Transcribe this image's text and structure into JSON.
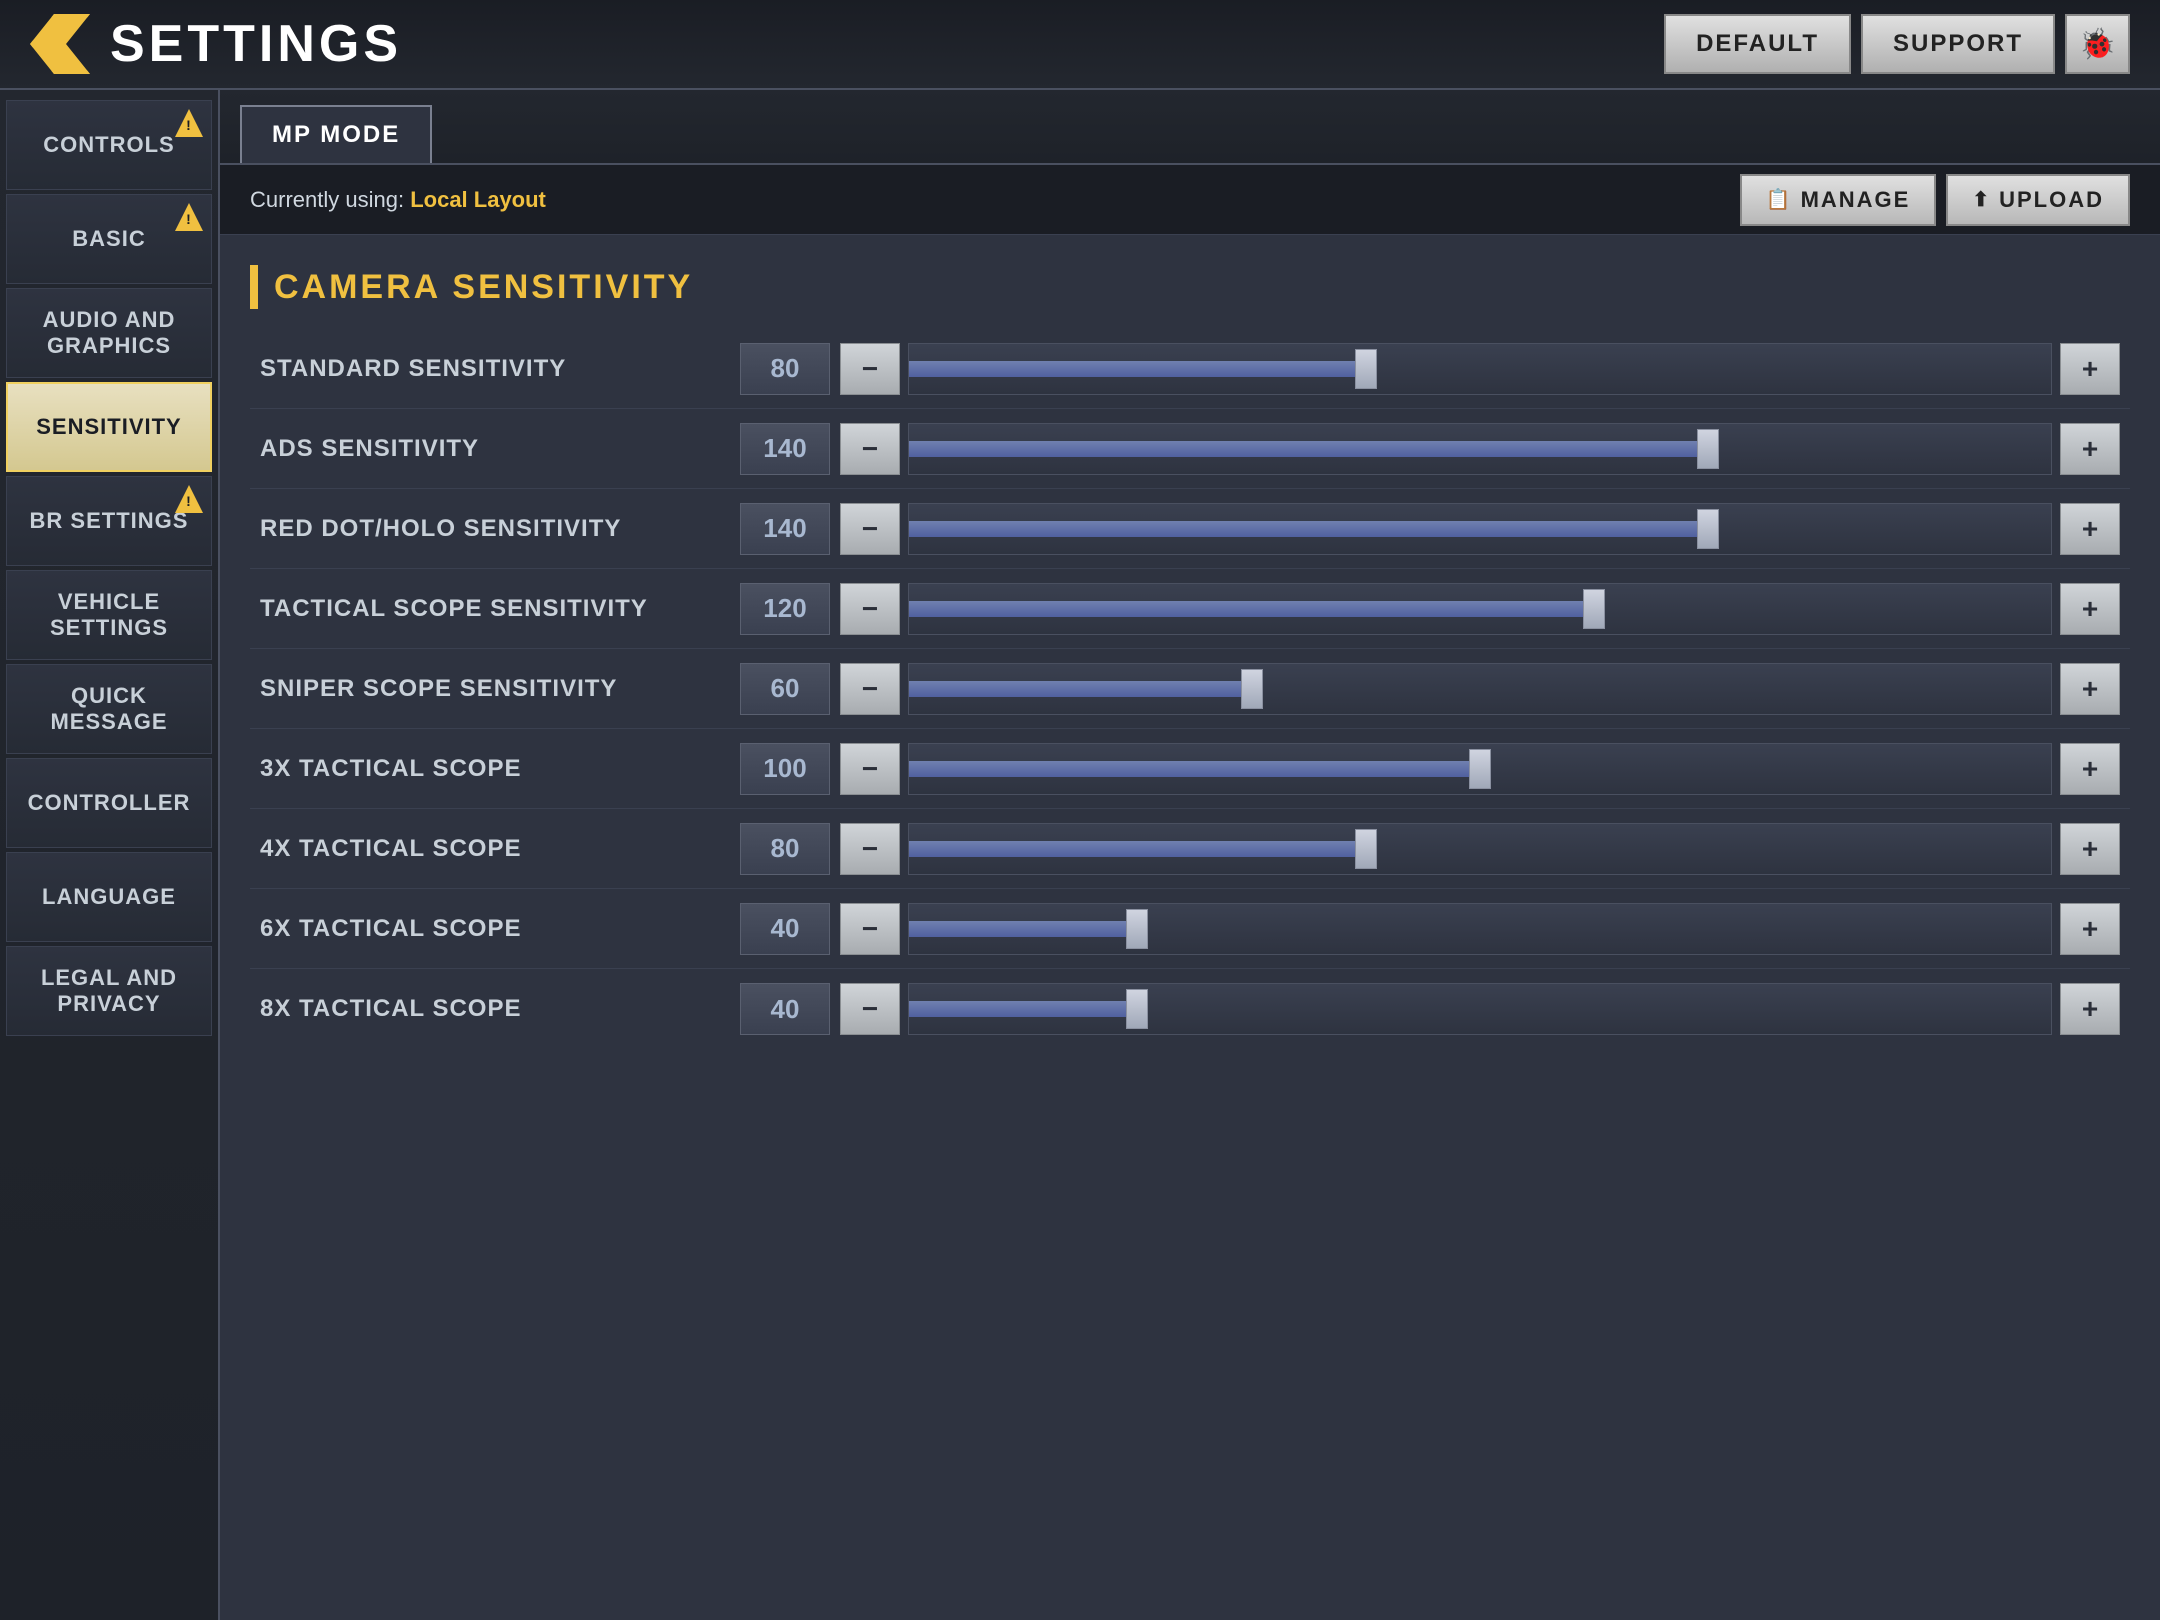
{
  "header": {
    "title": "SETTINGS",
    "back_icon": "◀",
    "buttons": {
      "default": "DEFAULT",
      "support": "SUPPORT",
      "bug": "🐞"
    }
  },
  "sidebar": {
    "items": [
      {
        "id": "controls",
        "label": "CONTROLS",
        "warning": true,
        "active": false
      },
      {
        "id": "basic",
        "label": "BASIC",
        "warning": true,
        "active": false
      },
      {
        "id": "audio-graphics",
        "label": "AUDIO AND GRAPHICS",
        "warning": false,
        "active": false
      },
      {
        "id": "sensitivity",
        "label": "SENSITIVITY",
        "warning": false,
        "active": true
      },
      {
        "id": "br-settings",
        "label": "BR SETTINGS",
        "warning": true,
        "active": false
      },
      {
        "id": "vehicle-settings",
        "label": "VEHICLE SETTINGS",
        "warning": false,
        "active": false
      },
      {
        "id": "quick-message",
        "label": "QUICK MESSAGE",
        "warning": false,
        "active": false
      },
      {
        "id": "controller",
        "label": "CONTROLLER",
        "warning": false,
        "active": false
      },
      {
        "id": "language",
        "label": "LANGUAGE",
        "warning": false,
        "active": false
      },
      {
        "id": "legal-privacy",
        "label": "LEGAL AND PRIVACY",
        "warning": false,
        "active": false
      }
    ]
  },
  "content": {
    "mode_tab": "MP MODE",
    "layout_bar": {
      "label": "Currently using:",
      "value": "Local Layout",
      "manage_btn": "MANAGE",
      "upload_btn": "UPLOAD"
    },
    "section_title": "CAMERA SENSITIVITY",
    "sliders": [
      {
        "id": "standard-sensitivity",
        "label": "STANDARD SENSITIVITY",
        "value": 80,
        "max": 200,
        "pct": 40
      },
      {
        "id": "ads-sensitivity",
        "label": "ADS SENSITIVITY",
        "value": 140,
        "max": 200,
        "pct": 70
      },
      {
        "id": "red-dot-holo",
        "label": "RED DOT/HOLO SENSITIVITY",
        "value": 140,
        "max": 200,
        "pct": 70
      },
      {
        "id": "tactical-scope",
        "label": "TACTICAL SCOPE SENSITIVITY",
        "value": 120,
        "max": 200,
        "pct": 60
      },
      {
        "id": "sniper-scope",
        "label": "SNIPER SCOPE SENSITIVITY",
        "value": 60,
        "max": 200,
        "pct": 30
      },
      {
        "id": "3x-tactical",
        "label": "3x TACTICAL SCOPE",
        "value": 100,
        "max": 200,
        "pct": 50
      },
      {
        "id": "4x-tactical",
        "label": "4x TACTICAL SCOPE",
        "value": 80,
        "max": 200,
        "pct": 40
      },
      {
        "id": "6x-tactical",
        "label": "6X TACTICAL SCOPE",
        "value": 40,
        "max": 200,
        "pct": 20
      },
      {
        "id": "8x-tactical",
        "label": "8X TACTICAL SCOPE",
        "value": 40,
        "max": 200,
        "pct": 20
      }
    ]
  }
}
